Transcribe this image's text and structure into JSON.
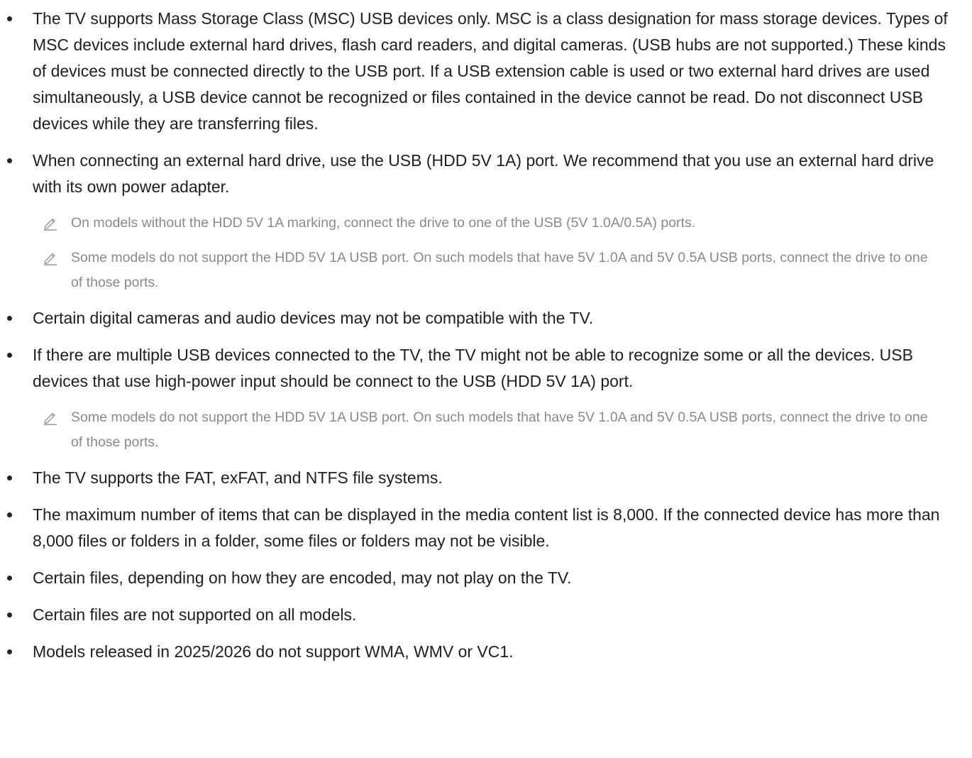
{
  "items": [
    {
      "type": "bullet",
      "text": "The TV supports Mass Storage Class (MSC) USB devices only. MSC is a class designation for mass storage devices. Types of MSC devices include external hard drives, flash card readers, and digital cameras. (USB hubs are not supported.) These kinds of devices must be connected directly to the USB port. If a USB extension cable is used or two external hard drives are used simultaneously, a USB device cannot be recognized or files contained in the device cannot be read. Do not disconnect USB devices while they are transferring files."
    },
    {
      "type": "bullet",
      "text": "When connecting an external hard drive, use the USB (HDD 5V 1A) port. We recommend that you use an external hard drive with its own power adapter."
    },
    {
      "type": "note",
      "icon": "pencil-icon",
      "text": "On models without the HDD 5V 1A marking, connect the drive to one of the USB (5V 1.0A/0.5A) ports."
    },
    {
      "type": "note",
      "icon": "pencil-icon",
      "text": "Some models do not support the HDD 5V 1A USB port. On such models that have 5V 1.0A and 5V 0.5A USB ports, connect the drive to one of those ports."
    },
    {
      "type": "bullet",
      "text": "Certain digital cameras and audio devices may not be compatible with the TV."
    },
    {
      "type": "bullet",
      "text": "If there are multiple USB devices connected to the TV, the TV might not be able to recognize some or all the devices. USB devices that use high-power input should be connect to the USB (HDD 5V 1A) port."
    },
    {
      "type": "note",
      "icon": "pencil-icon",
      "text": "Some models do not support the HDD 5V 1A USB port. On such models that have 5V 1.0A and 5V 0.5A USB ports, connect the drive to one of those ports."
    },
    {
      "type": "bullet",
      "text": "The TV supports the FAT, exFAT, and NTFS file systems."
    },
    {
      "type": "bullet",
      "text": "The maximum number of items that can be displayed in the media content list is 8,000. If the connected device has more than 8,000 files or folders in a folder, some files or folders may not be visible."
    },
    {
      "type": "bullet",
      "text": "Certain files, depending on how they are encoded, may not play on the TV."
    },
    {
      "type": "bullet",
      "text": "Certain files are not supported on all models."
    },
    {
      "type": "bullet",
      "text": "Models released in 2025/2026 do not support WMA, WMV or VC1."
    }
  ],
  "colors": {
    "bullet_text": "#1f1f1f",
    "note_text": "#8a8a8a",
    "background": "#ffffff"
  }
}
